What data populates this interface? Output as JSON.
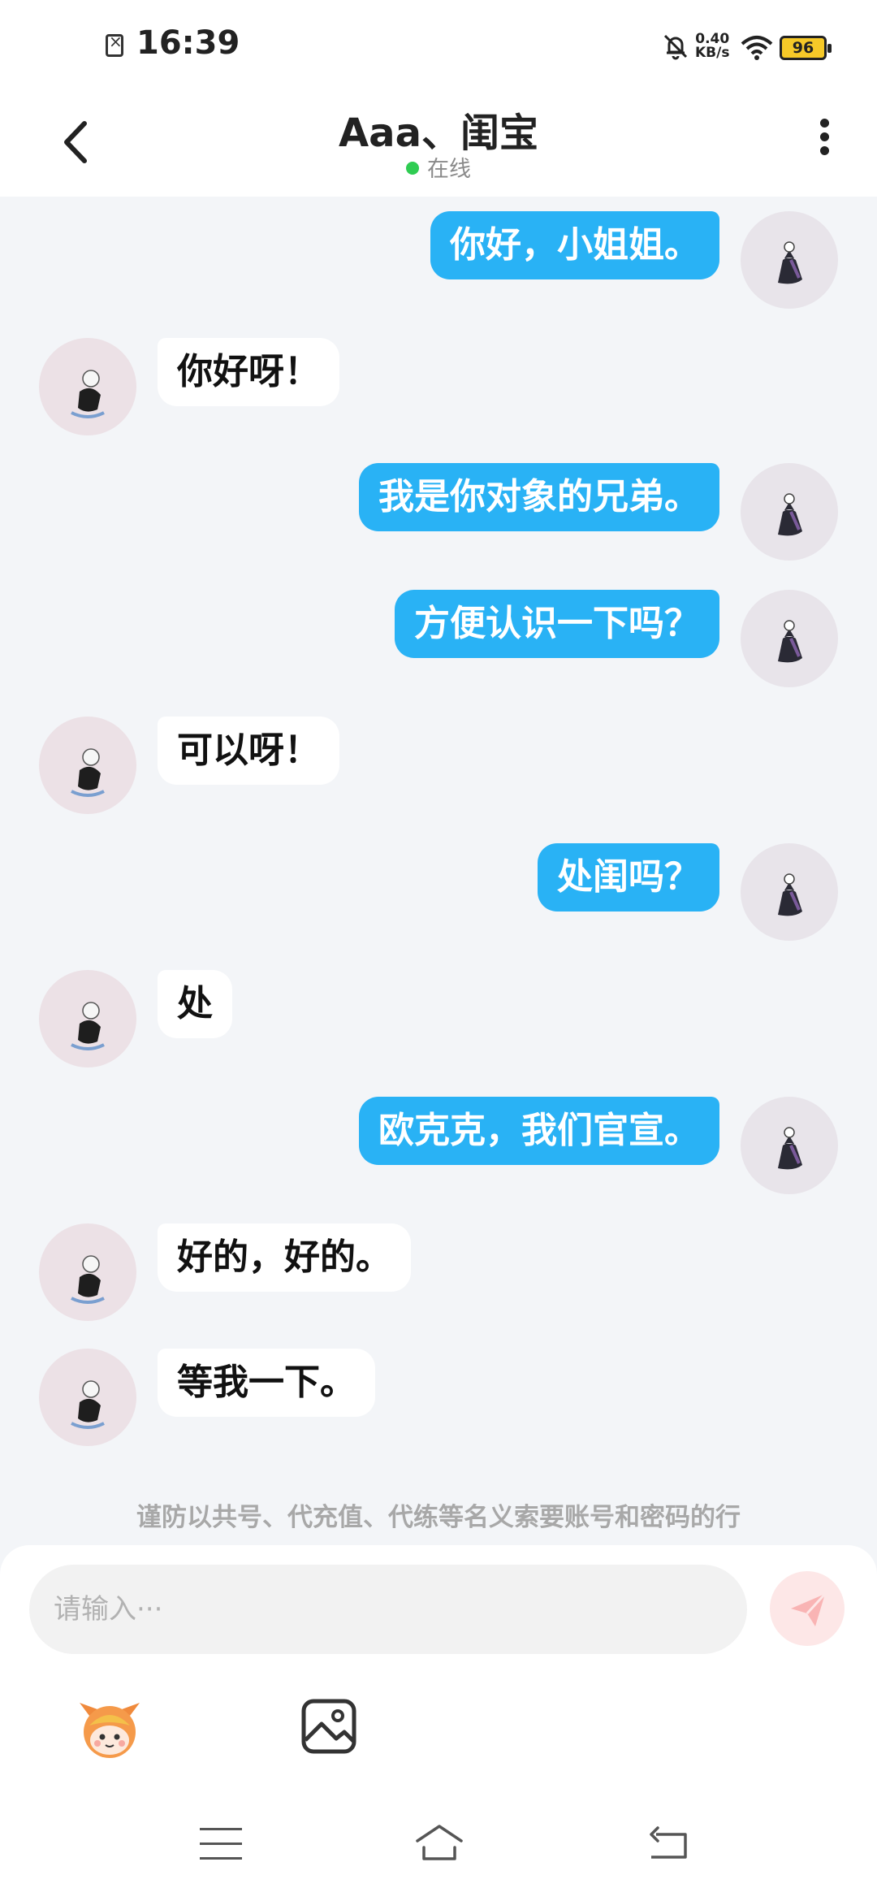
{
  "status_bar": {
    "time": "16:39",
    "net_speed_value": "0.40",
    "net_speed_unit": "KB/s",
    "battery": "96",
    "icons": [
      "sim-off-icon",
      "mute-bell-icon",
      "wifi-icon",
      "battery-icon"
    ]
  },
  "header": {
    "title": "Aaa、闺宝",
    "status": "在线",
    "status_color": "#2fcc52"
  },
  "messages": [
    {
      "side": "out",
      "text": "你好，小姐姐。"
    },
    {
      "side": "in",
      "text": "你好呀！"
    },
    {
      "side": "out",
      "text": "我是你对象的兄弟。"
    },
    {
      "side": "out",
      "text": "方便认识一下吗？"
    },
    {
      "side": "in",
      "text": "可以呀！"
    },
    {
      "side": "out",
      "text": "处闺吗？"
    },
    {
      "side": "in",
      "text": "处"
    },
    {
      "side": "out",
      "text": "欧克克，我们官宣。"
    },
    {
      "side": "in",
      "text": "好的，好的。"
    },
    {
      "side": "in",
      "text": "等我一下。"
    }
  ],
  "notice": "谨防以共号、代充值、代练等名义索要账号和密码的行",
  "composer": {
    "placeholder": "请输入···",
    "send_icon": "send-icon",
    "tools": [
      "emoji-icon",
      "image-icon"
    ]
  },
  "nav": {
    "icons": [
      "menu-icon",
      "home-icon",
      "back-icon"
    ]
  },
  "colors": {
    "outgoing_bubble": "#29b2f5",
    "incoming_bubble": "#ffffff",
    "background": "#f3f5f8"
  }
}
